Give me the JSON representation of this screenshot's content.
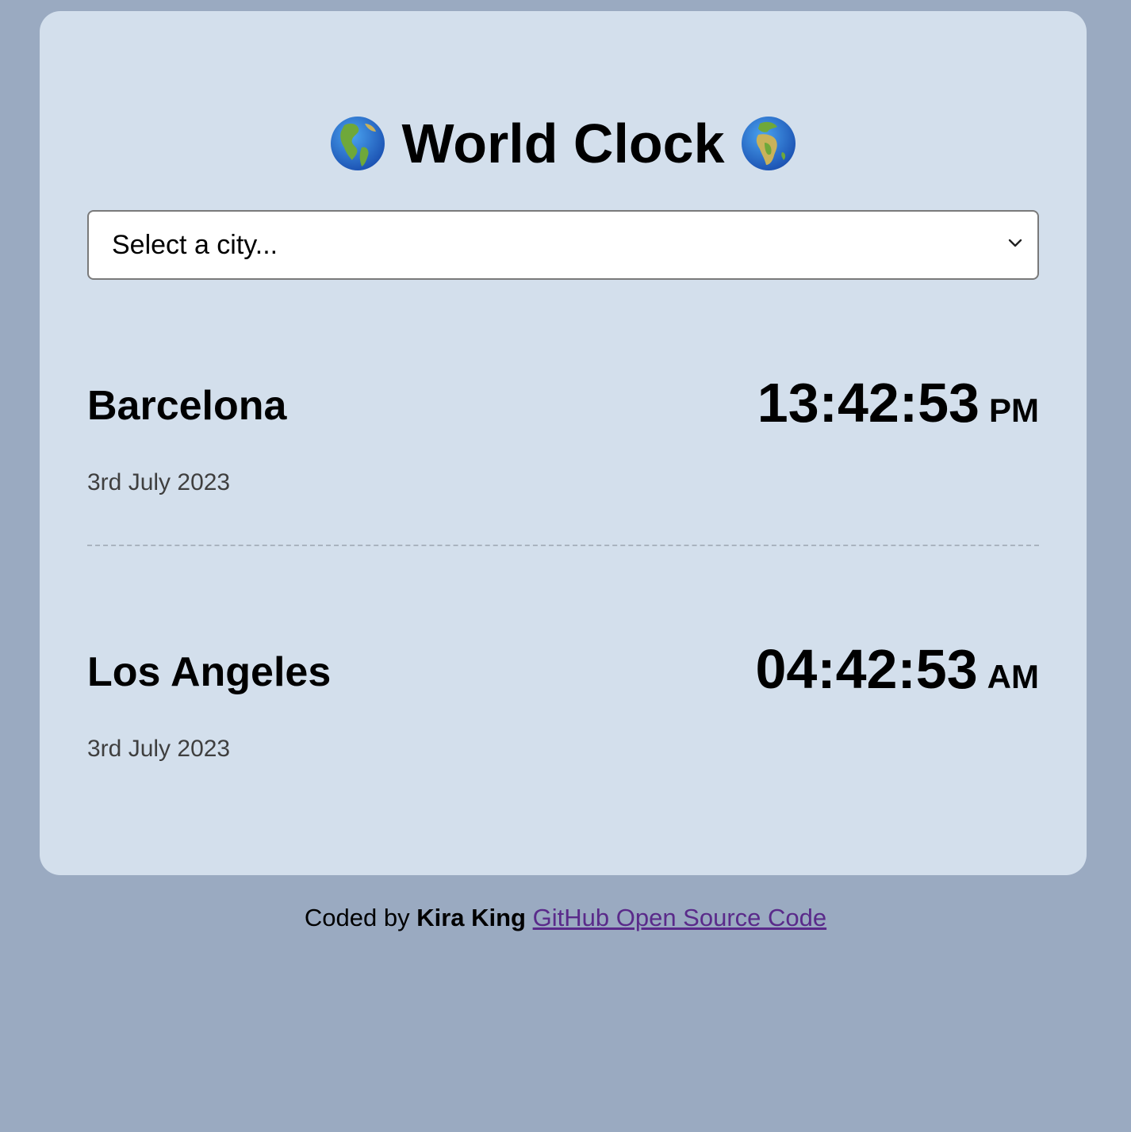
{
  "header": {
    "title": "World Clock",
    "left_icon": "globe-americas-icon",
    "right_icon": "globe-europe-africa-icon"
  },
  "city_select": {
    "selected_label": "Select a city..."
  },
  "cities": [
    {
      "name": "Barcelona",
      "time": "13:42:53",
      "ampm": "PM",
      "date": "3rd July 2023"
    },
    {
      "name": "Los Angeles",
      "time": "04:42:53",
      "ampm": "AM",
      "date": "3rd July 2023"
    }
  ],
  "footer": {
    "prefix": "Coded by",
    "author": "Kira King",
    "link_text": "GitHub Open Source Code"
  },
  "colors": {
    "page_background": "#9aaac1",
    "card_background": "#d3dfec",
    "link": "#5a2a8a",
    "date_text": "#3f3f3f"
  }
}
